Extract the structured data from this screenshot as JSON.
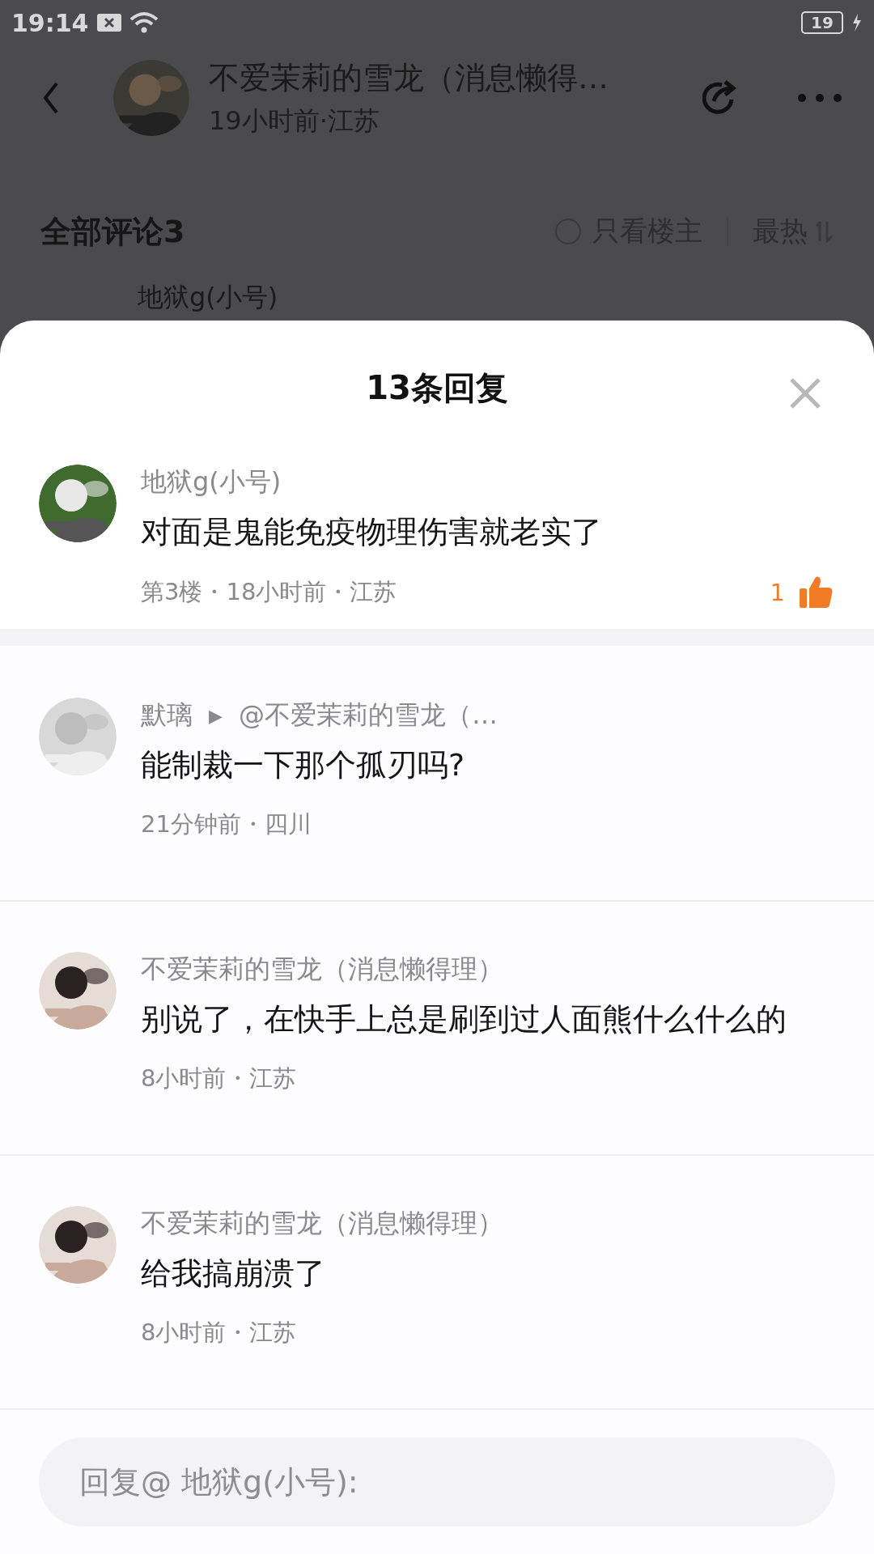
{
  "status_bar": {
    "time": "19:14",
    "battery": "19"
  },
  "post_header": {
    "author": "不爱茉莉的雪龙（消息懒得…",
    "meta": "19小时前·江苏"
  },
  "comments_header": {
    "title": "全部评论3",
    "only_op": {
      "label": "只看楼主",
      "checked": false
    },
    "sort": "最热"
  },
  "background_comment": {
    "author": "地狱g(小号)"
  },
  "sheet": {
    "title": "13条回复",
    "main_comment": {
      "author": "地狱g(小号)",
      "text": "对面是鬼能免疫物理伤害就老实了",
      "meta": "第3楼・18小时前・江苏",
      "likes": "1",
      "liked": true
    },
    "replies": [
      {
        "author": "默璃",
        "arrow": "▶",
        "reply_to": "@不爱茉莉的雪龙（…",
        "text": "能制裁一下那个孤刃吗?",
        "meta": "21分钟前・四川"
      },
      {
        "author": "不爱茉莉的雪龙（消息懒得理）",
        "text": "别说了，在快手上总是刷到过人面熊什么什么的",
        "meta": "8小时前・江苏"
      },
      {
        "author": "不爱茉莉的雪龙（消息懒得理）",
        "text": "给我搞崩溃了",
        "meta": "8小时前・江苏"
      }
    ],
    "reply_field": {
      "placeholder": "回复@ 地狱g(小号):"
    }
  }
}
